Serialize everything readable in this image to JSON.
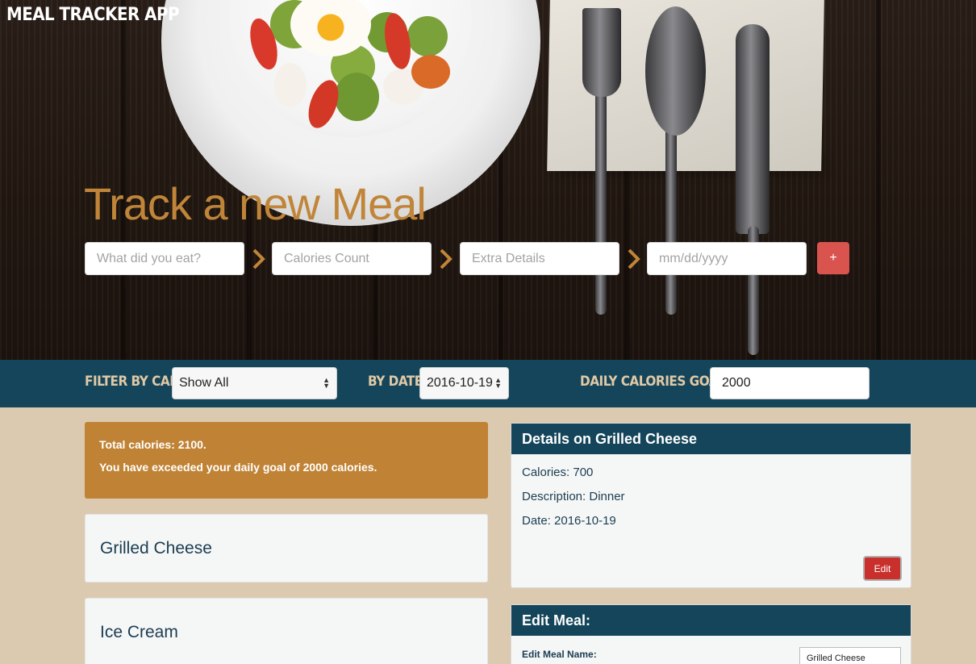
{
  "app": {
    "title": "MEAL TRACKER APP"
  },
  "hero": {
    "heading": "Track a new Meal",
    "inputs": {
      "name_placeholder": "What did you eat?",
      "calories_placeholder": "Calories Count",
      "details_placeholder": "Extra Details",
      "date_placeholder": "mm/dd/yyyy"
    },
    "add_label": "+"
  },
  "filters": {
    "calories_label": "FILTER BY CAL:",
    "calories_selected": "Show All",
    "date_label": "BY DATE",
    "date_selected": "2016-10-19",
    "goal_label": "DAILY CALORIES GOAL:",
    "goal_value": "2000"
  },
  "summary": {
    "total": "Total calories: 2100.",
    "message": "You have exceeded your daily goal of 2000 calories."
  },
  "meals": [
    {
      "name": "Grilled Cheese"
    },
    {
      "name": "Ice Cream"
    }
  ],
  "details": {
    "title": "Details on Grilled Cheese",
    "calories": "Calories: 700",
    "description": "Description: Dinner",
    "date": "Date: 2016-10-19",
    "edit_label": "Edit"
  },
  "edit_meal": {
    "title": "Edit Meal:",
    "name_label": "Edit Meal Name:",
    "name_value": "Grilled Cheese"
  },
  "colors": {
    "accent": "#c08539",
    "navy": "#14455a",
    "background": "#dccab0",
    "danger": "#d9534f"
  }
}
